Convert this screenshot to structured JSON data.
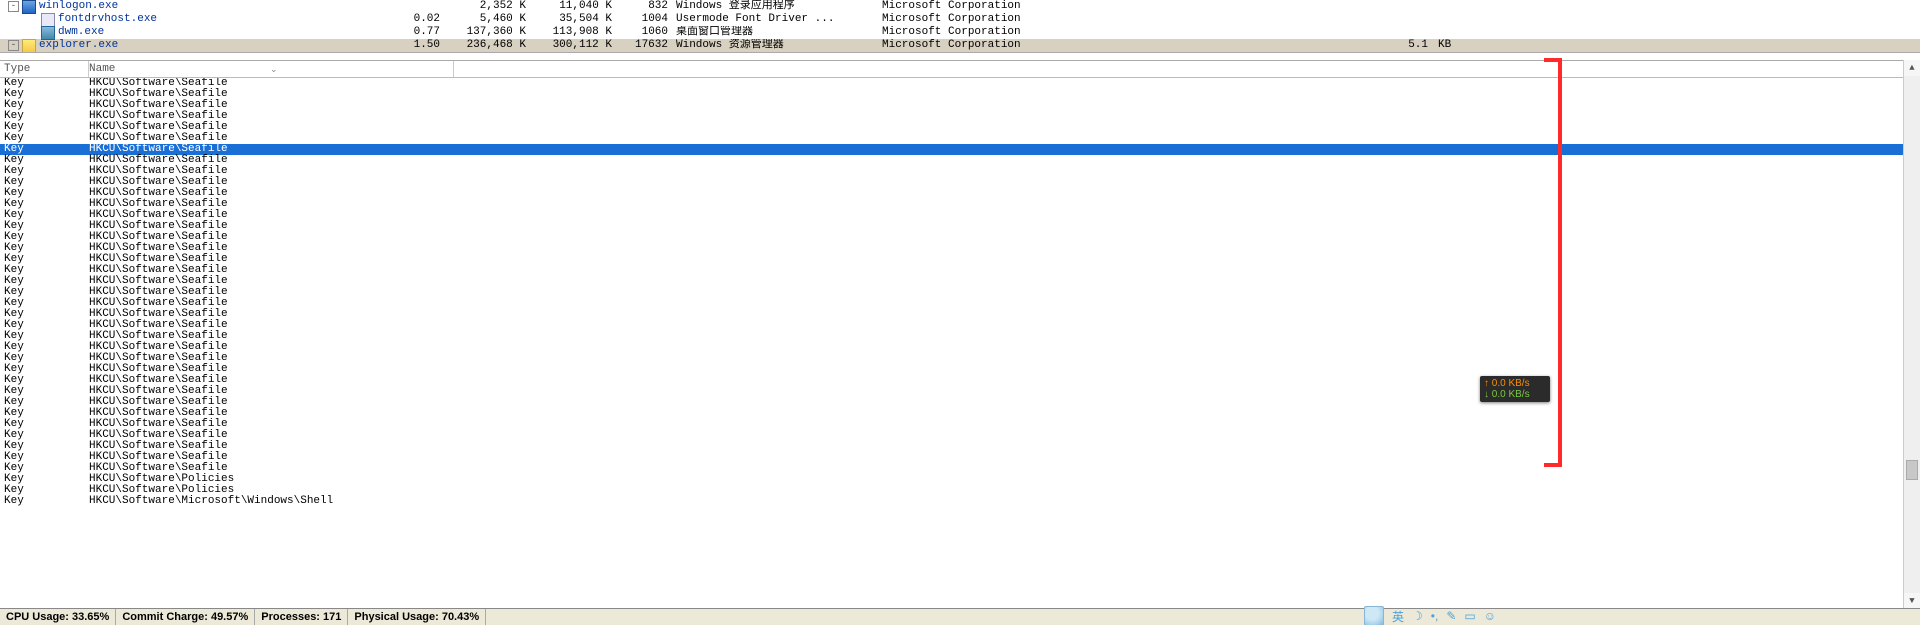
{
  "process_tree": [
    {
      "indent": 8,
      "toggle": "-",
      "icon": "winlogon",
      "name": "winlogon.exe",
      "selected": false
    },
    {
      "indent": 28,
      "toggle": "",
      "icon": "font",
      "name": "fontdrvhost.exe",
      "selected": false
    },
    {
      "indent": 28,
      "toggle": "",
      "icon": "dwm",
      "name": "dwm.exe",
      "selected": false
    },
    {
      "indent": 8,
      "toggle": "-",
      "icon": "explorer",
      "name": "explorer.exe",
      "selected": true
    }
  ],
  "process_metrics": [
    {
      "cpu": "",
      "priv": "2,352 K",
      "ws": "11,040 K",
      "pid": "832",
      "desc": "Windows 登录应用程序",
      "comp": "Microsoft Corporation",
      "io1": "",
      "io2": "",
      "selected": false
    },
    {
      "cpu": "0.02",
      "priv": "5,460 K",
      "ws": "35,504 K",
      "pid": "1004",
      "desc": "Usermode Font Driver ...",
      "comp": "Microsoft Corporation",
      "io1": "",
      "io2": "",
      "selected": false
    },
    {
      "cpu": "0.77",
      "priv": "137,360 K",
      "ws": "113,908 K",
      "pid": "1060",
      "desc": "桌面窗口管理器",
      "comp": "Microsoft Corporation",
      "io1": "",
      "io2": "",
      "selected": false
    },
    {
      "cpu": "1.50",
      "priv": "236,468 K",
      "ws": "300,112 K",
      "pid": "17632",
      "desc": "Windows 资源管理器",
      "comp": "Microsoft Corporation",
      "io1": "5.1",
      "io2": "KB",
      "selected": true
    }
  ],
  "reg_headers": {
    "type": "Type",
    "name": "Name",
    "sort_glyph": "⌄"
  },
  "reg_rows": [
    {
      "type": "Key",
      "name": "HKCU\\Software\\Seafile",
      "selected": false
    },
    {
      "type": "Key",
      "name": "HKCU\\Software\\Seafile",
      "selected": false
    },
    {
      "type": "Key",
      "name": "HKCU\\Software\\Seafile",
      "selected": false
    },
    {
      "type": "Key",
      "name": "HKCU\\Software\\Seafile",
      "selected": false
    },
    {
      "type": "Key",
      "name": "HKCU\\Software\\Seafile",
      "selected": false
    },
    {
      "type": "Key",
      "name": "HKCU\\Software\\Seafile",
      "selected": false
    },
    {
      "type": "Key",
      "name": "HKCU\\Software\\Seafile",
      "selected": true
    },
    {
      "type": "Key",
      "name": "HKCU\\Software\\Seafile",
      "selected": false
    },
    {
      "type": "Key",
      "name": "HKCU\\Software\\Seafile",
      "selected": false
    },
    {
      "type": "Key",
      "name": "HKCU\\Software\\Seafile",
      "selected": false
    },
    {
      "type": "Key",
      "name": "HKCU\\Software\\Seafile",
      "selected": false
    },
    {
      "type": "Key",
      "name": "HKCU\\Software\\Seafile",
      "selected": false
    },
    {
      "type": "Key",
      "name": "HKCU\\Software\\Seafile",
      "selected": false
    },
    {
      "type": "Key",
      "name": "HKCU\\Software\\Seafile",
      "selected": false
    },
    {
      "type": "Key",
      "name": "HKCU\\Software\\Seafile",
      "selected": false
    },
    {
      "type": "Key",
      "name": "HKCU\\Software\\Seafile",
      "selected": false
    },
    {
      "type": "Key",
      "name": "HKCU\\Software\\Seafile",
      "selected": false
    },
    {
      "type": "Key",
      "name": "HKCU\\Software\\Seafile",
      "selected": false
    },
    {
      "type": "Key",
      "name": "HKCU\\Software\\Seafile",
      "selected": false
    },
    {
      "type": "Key",
      "name": "HKCU\\Software\\Seafile",
      "selected": false
    },
    {
      "type": "Key",
      "name": "HKCU\\Software\\Seafile",
      "selected": false
    },
    {
      "type": "Key",
      "name": "HKCU\\Software\\Seafile",
      "selected": false
    },
    {
      "type": "Key",
      "name": "HKCU\\Software\\Seafile",
      "selected": false
    },
    {
      "type": "Key",
      "name": "HKCU\\Software\\Seafile",
      "selected": false
    },
    {
      "type": "Key",
      "name": "HKCU\\Software\\Seafile",
      "selected": false
    },
    {
      "type": "Key",
      "name": "HKCU\\Software\\Seafile",
      "selected": false
    },
    {
      "type": "Key",
      "name": "HKCU\\Software\\Seafile",
      "selected": false
    },
    {
      "type": "Key",
      "name": "HKCU\\Software\\Seafile",
      "selected": false
    },
    {
      "type": "Key",
      "name": "HKCU\\Software\\Seafile",
      "selected": false
    },
    {
      "type": "Key",
      "name": "HKCU\\Software\\Seafile",
      "selected": false
    },
    {
      "type": "Key",
      "name": "HKCU\\Software\\Seafile",
      "selected": false
    },
    {
      "type": "Key",
      "name": "HKCU\\Software\\Seafile",
      "selected": false
    },
    {
      "type": "Key",
      "name": "HKCU\\Software\\Seafile",
      "selected": false
    },
    {
      "type": "Key",
      "name": "HKCU\\Software\\Seafile",
      "selected": false
    },
    {
      "type": "Key",
      "name": "HKCU\\Software\\Seafile",
      "selected": false
    },
    {
      "type": "Key",
      "name": "HKCU\\Software\\Seafile",
      "selected": false
    },
    {
      "type": "Key",
      "name": "HKCU\\Software\\Policies",
      "selected": false
    },
    {
      "type": "Key",
      "name": "HKCU\\Software\\Policies",
      "selected": false
    },
    {
      "type": "Key",
      "name": "HKCU\\Software\\Microsoft\\Windows\\Shell",
      "selected": false
    }
  ],
  "status_bar": {
    "cpu": "CPU Usage: 33.65%",
    "commit": "Commit Charge: 49.57%",
    "procs": "Processes: 171",
    "physical": "Physical Usage: 70.43%"
  },
  "netmon": {
    "up_arrow": "↑",
    "up_text": "0.0 KB/s",
    "down_arrow": "↓",
    "down_text": "0.0 KB/s"
  },
  "ime": {
    "lang": "英",
    "moon": "☽",
    "punct": "•,",
    "tool": "✎",
    "box": "▭",
    "smile": "☺"
  },
  "scroll": {
    "up_glyph": "▲",
    "down_glyph": "▼"
  }
}
